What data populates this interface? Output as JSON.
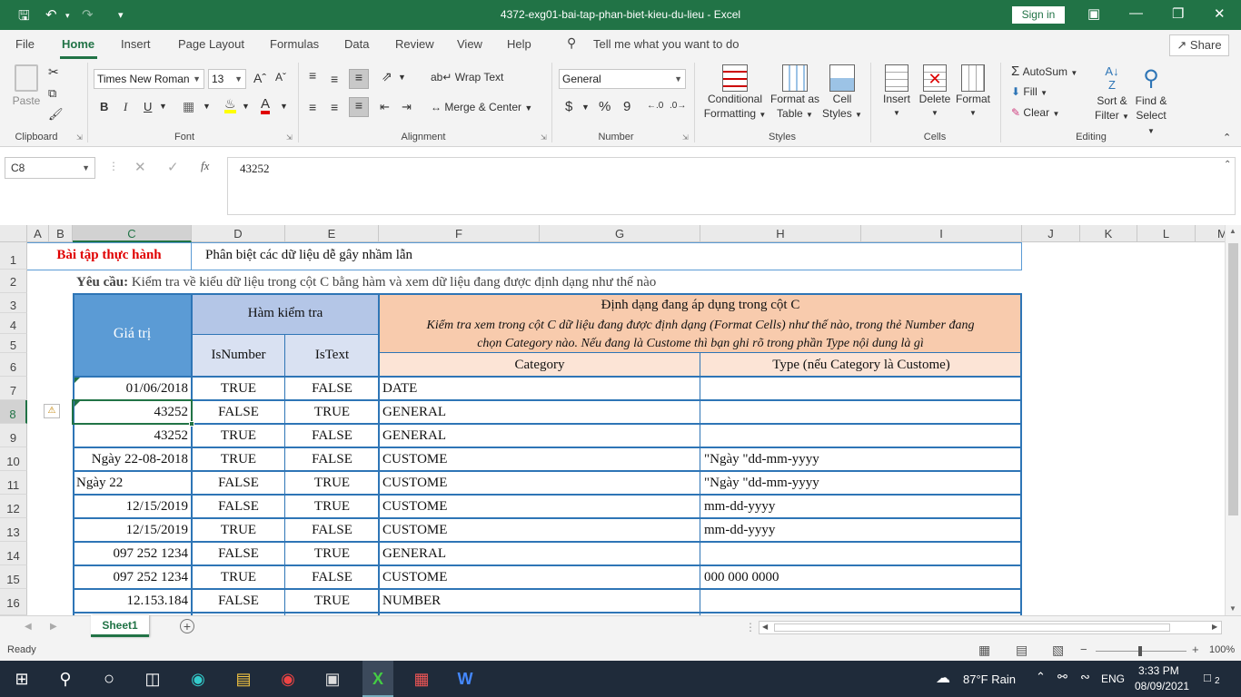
{
  "app": {
    "file_title": "4372-exg01-bai-tap-phan-biet-kieu-du-lieu  -  Excel",
    "sign_in": "Sign in",
    "share": "Share"
  },
  "menu": {
    "tabs": [
      "File",
      "Home",
      "Insert",
      "Page Layout",
      "Formulas",
      "Data",
      "Review",
      "View",
      "Help"
    ],
    "tell_me": "Tell me what you want to do"
  },
  "ribbon": {
    "clipboard": {
      "paste": "Paste",
      "group": "Clipboard"
    },
    "font": {
      "name": "Times New Roman",
      "size": "13",
      "bold": "B",
      "italic": "I",
      "underline": "U",
      "group": "Font"
    },
    "alignment": {
      "wrap_text": "Wrap Text",
      "merge_center": "Merge & Center",
      "group": "Alignment"
    },
    "number": {
      "format": "General",
      "currency": "$",
      "percent": "%",
      "comma": "9",
      "group": "Number"
    },
    "styles": {
      "conditional_formatting": "Conditional Formatting",
      "cf1": "Conditional",
      "cf2": "Formatting",
      "fat1": "Format as",
      "fat2": "Table",
      "cs1": "Cell",
      "cs2": "Styles",
      "group": "Styles"
    },
    "cells": {
      "insert": "Insert",
      "delete": "Delete",
      "format": "Format",
      "group": "Cells"
    },
    "editing": {
      "autosum": "AutoSum",
      "fill": "Fill",
      "clear": "Clear",
      "sort1": "Sort &",
      "sort2": "Filter",
      "find1": "Find &",
      "find2": "Select",
      "group": "Editing"
    }
  },
  "formula_bar": {
    "name_box": "C8",
    "fx": "fx",
    "value": "43252"
  },
  "columns": [
    "A",
    "B",
    "C",
    "D",
    "E",
    "F",
    "G",
    "H",
    "I",
    "J",
    "K",
    "L",
    "M"
  ],
  "rows": [
    "1",
    "2",
    "3",
    "4",
    "5",
    "6",
    "7",
    "8",
    "9",
    "10",
    "11",
    "12",
    "13",
    "14",
    "15",
    "16"
  ],
  "sheet": {
    "title_red": "Bài tập thực hành",
    "title_sub": "Phân biệt các dữ liệu dễ gây nhầm lẫn",
    "req_bold": "Yêu cầu:",
    "req_text": " Kiểm tra về kiểu dữ liệu trong cột C bằng hàm và xem dữ liệu đang được định dạng như thế nào",
    "hdr_value": "Giá trị",
    "hdr_check": "Hàm kiểm tra",
    "hdr_isnumber": "IsNumber",
    "hdr_istext": "IsText",
    "hdr_format": "Định dạng đang áp dụng trong cột C",
    "hdr_format_desc1": "Kiểm tra xem trong cột C dữ liệu đang được định dạng (Format Cells) như thế nào, trong thẻ Number đang",
    "hdr_format_desc2": "chọn Category nào. Nếu đang là Custome thì bạn ghi rõ trong phần Type nội dung là gì",
    "hdr_category": "Category",
    "hdr_type": "Type (nếu Category là Custome)",
    "data": [
      {
        "value": "01/06/2018",
        "align": "right",
        "isnum": "TRUE",
        "istext": "FALSE",
        "cat": "DATE",
        "type": ""
      },
      {
        "value": "43252",
        "align": "right",
        "isnum": "FALSE",
        "istext": "TRUE",
        "cat": "GENERAL",
        "type": ""
      },
      {
        "value": "43252",
        "align": "right",
        "isnum": "TRUE",
        "istext": "FALSE",
        "cat": "GENERAL",
        "type": ""
      },
      {
        "value": "Ngày 22-08-2018",
        "align": "right",
        "isnum": "TRUE",
        "istext": "FALSE",
        "cat": "CUSTOME",
        "type": "\"Ngày \"dd-mm-yyyy"
      },
      {
        "value": "Ngày 22",
        "align": "left",
        "isnum": "FALSE",
        "istext": "TRUE",
        "cat": "CUSTOME",
        "type": "\"Ngày \"dd-mm-yyyy"
      },
      {
        "value": "12/15/2019",
        "align": "right",
        "isnum": "FALSE",
        "istext": "TRUE",
        "cat": "CUSTOME",
        "type": "mm-dd-yyyy"
      },
      {
        "value": "12/15/2019",
        "align": "right",
        "isnum": "TRUE",
        "istext": "FALSE",
        "cat": "CUSTOME",
        "type": "mm-dd-yyyy"
      },
      {
        "value": "097 252 1234",
        "align": "right",
        "isnum": "FALSE",
        "istext": "TRUE",
        "cat": "GENERAL",
        "type": ""
      },
      {
        "value": "097 252 1234",
        "align": "right",
        "isnum": "TRUE",
        "istext": "FALSE",
        "cat": "CUSTOME",
        "type": "000 000 0000"
      },
      {
        "value": "12.153.184",
        "align": "right",
        "isnum": "FALSE",
        "istext": "TRUE",
        "cat": "NUMBER",
        "type": ""
      }
    ]
  },
  "tabs": {
    "sheet1": "Sheet1"
  },
  "status": {
    "ready": "Ready",
    "zoom": "100%"
  },
  "taskbar": {
    "weather": "87°F  Rain",
    "lang": "ENG",
    "time": "3:33 PM",
    "date": "08/09/2021",
    "notif": "2"
  },
  "colors": {
    "excel_green": "#217346",
    "header_blue": "#5b9bd5",
    "light_blue": "#b4c6e7",
    "lighter_blue": "#d9e1f2",
    "peach": "#f8cbad",
    "light_peach": "#fce4d6",
    "title_red": "#e00000"
  }
}
